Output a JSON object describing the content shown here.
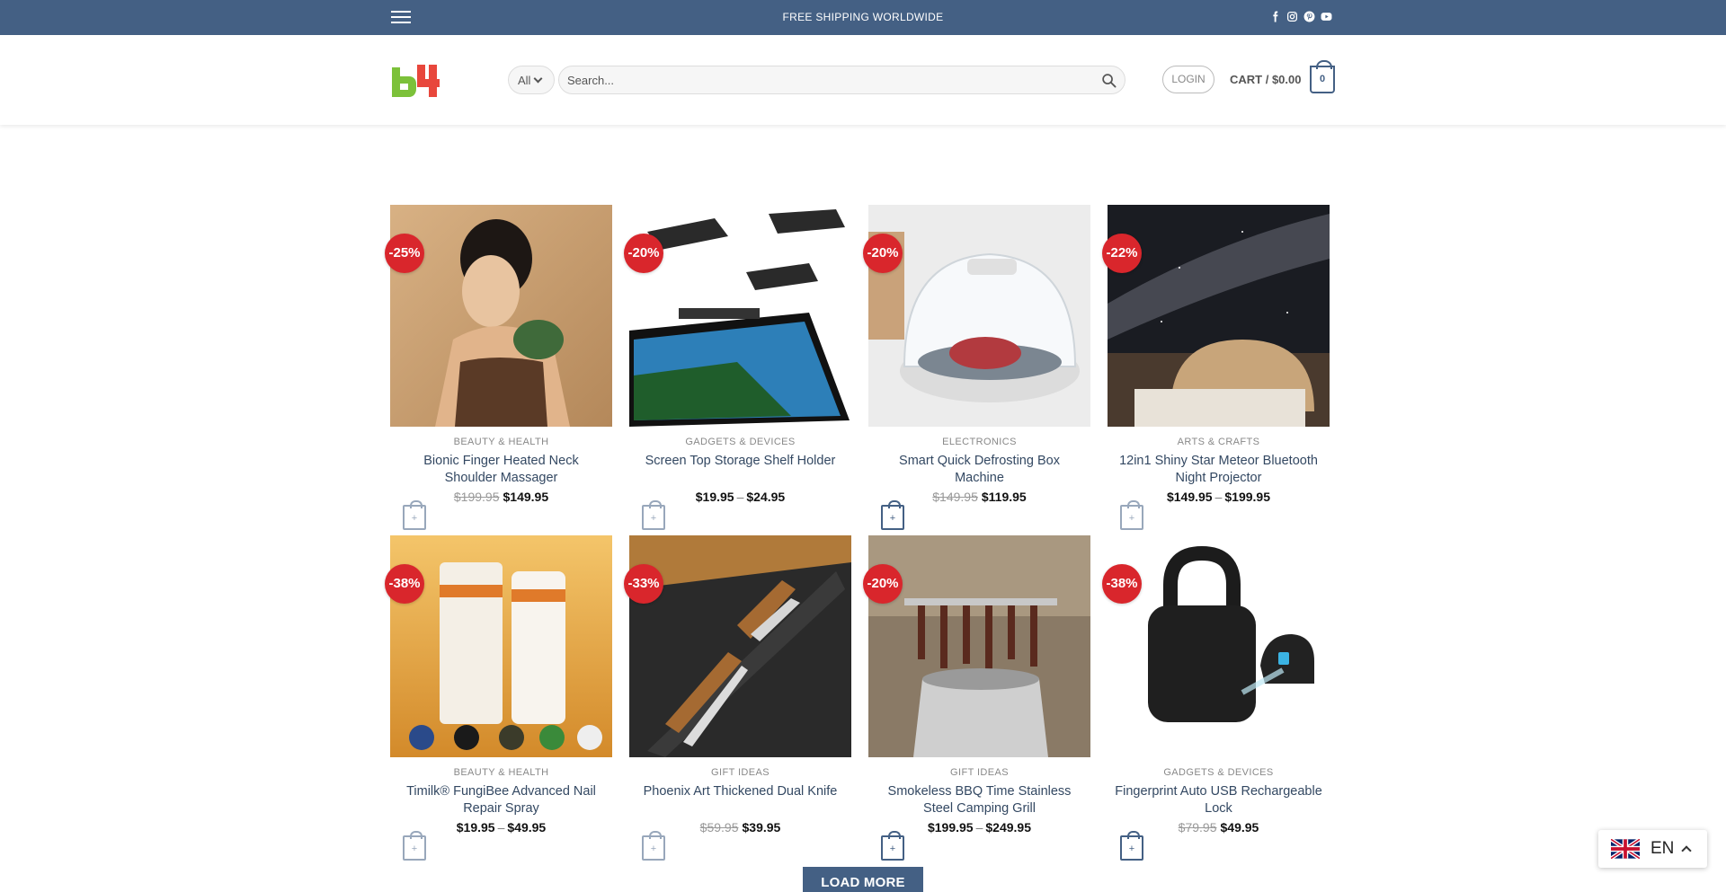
{
  "topbar": {
    "shipping_text": "FREE SHIPPING WORLDWIDE",
    "socials": [
      "facebook-icon",
      "instagram-icon",
      "pinterest-icon",
      "youtube-icon"
    ],
    "background": "#446084"
  },
  "header": {
    "category_select": "All",
    "search_placeholder": "Search...",
    "login_label": "LOGIN",
    "cart_label": "CART / $0.00",
    "cart_count": "0"
  },
  "products": [
    {
      "badge": "-25%",
      "category": "BEAUTY & HEALTH",
      "name": "Bionic Finger Heated Neck Shoulder Massager",
      "price_old": "$199.95",
      "price_new": "$149.95",
      "price_min": "",
      "price_max": ""
    },
    {
      "badge": "-20%",
      "category": "GADGETS & DEVICES",
      "name": "Screen Top Storage Shelf Holder",
      "price_old": "",
      "price_new": "",
      "price_min": "$19.95",
      "price_max": "$24.95"
    },
    {
      "badge": "-20%",
      "category": "ELECTRONICS",
      "name": "Smart Quick Defrosting Box Machine",
      "price_old": "$149.95",
      "price_new": "$119.95",
      "price_min": "",
      "price_max": ""
    },
    {
      "badge": "-22%",
      "category": "ARTS & CRAFTS",
      "name": "12in1 Shiny Star Meteor Bluetooth Night Projector",
      "price_old": "",
      "price_new": "",
      "price_min": "$149.95",
      "price_max": "$199.95"
    },
    {
      "badge": "-38%",
      "category": "BEAUTY & HEALTH",
      "name": "Timilk® FungiBee Advanced Nail Repair Spray",
      "price_old": "",
      "price_new": "",
      "price_min": "$19.95",
      "price_max": "$49.95"
    },
    {
      "badge": "-33%",
      "category": "GIFT IDEAS",
      "name": "Phoenix Art Thickened Dual Knife",
      "price_old": "$59.95",
      "price_new": "$39.95",
      "price_min": "",
      "price_max": ""
    },
    {
      "badge": "-20%",
      "category": "GIFT IDEAS",
      "name": "Smokeless BBQ Time Stainless Steel Camping Grill",
      "price_old": "",
      "price_new": "",
      "price_min": "$199.95",
      "price_max": "$249.95"
    },
    {
      "badge": "-38%",
      "category": "GADGETS & DEVICES",
      "name": "Fingerprint Auto USB Rechargeable Lock",
      "price_old": "$79.95",
      "price_new": "$49.95",
      "price_min": "",
      "price_max": ""
    }
  ],
  "price_separator": "–",
  "load_more_label": "LOAD MORE",
  "language": {
    "label": "EN",
    "flag": "uk-flag-icon"
  },
  "colors": {
    "accent": "#446084",
    "sale_badge": "#d9262c",
    "link": "#334862"
  }
}
